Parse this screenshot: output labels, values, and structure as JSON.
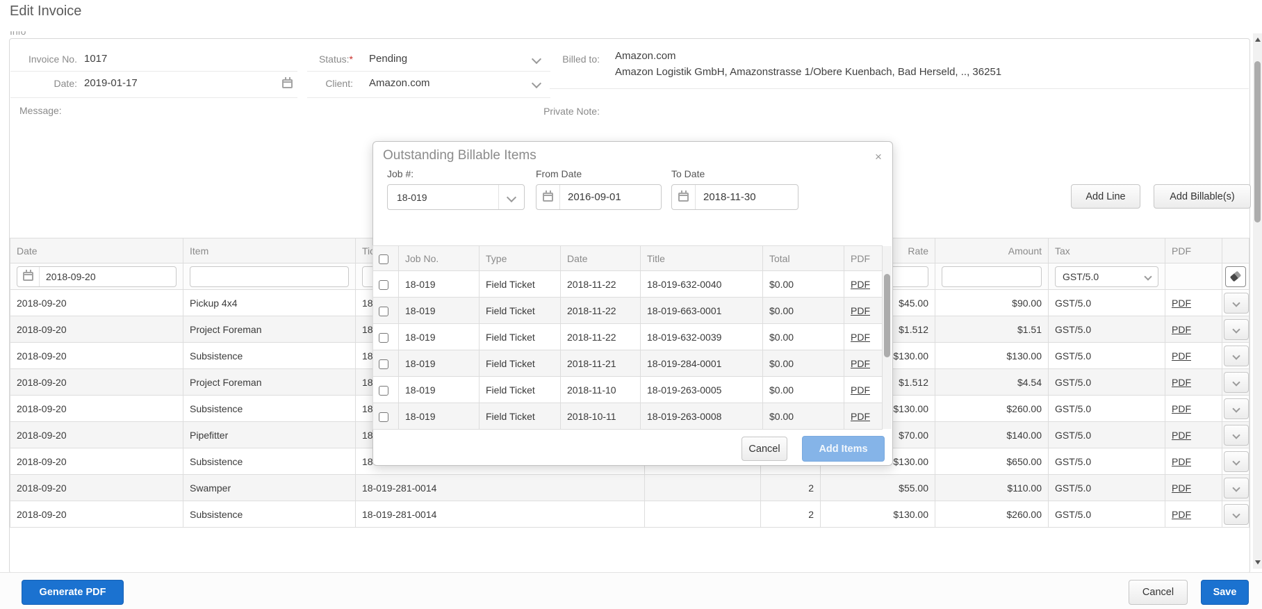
{
  "page": {
    "title": "Edit Invoice",
    "tab_fragment": "Info"
  },
  "form": {
    "invoice_no": {
      "label": "Invoice No.",
      "value": "1017"
    },
    "status": {
      "label": "Status:",
      "required_mark": "*",
      "value": "Pending"
    },
    "date": {
      "label": "Date:",
      "value": "2019-01-17"
    },
    "client": {
      "label": "Client:",
      "value": "Amazon.com"
    },
    "billed_to": {
      "label": "Billed to:",
      "line1": "Amazon.com",
      "line2": "Amazon Logistik GmbH, Amazonstrasse 1/Obere Kuenbach, Bad Herseld, .., 36251"
    },
    "message_label": "Message:",
    "private_note_label": "Private Note:"
  },
  "toolbar": {
    "add_line": "Add Line",
    "add_billables": "Add Billable(s)"
  },
  "invoice_table": {
    "headers": {
      "date": "Date",
      "item": "Item",
      "ticket": "Ticket No.",
      "rate": "Rate",
      "amount": "Amount",
      "tax": "Tax",
      "pdf": "PDF"
    },
    "filters": {
      "date": "2018-09-20",
      "tax": "GST/5.0"
    },
    "rows": [
      {
        "date": "2018-09-20",
        "item": "Pickup 4x4",
        "ticket": "18",
        "qty": "",
        "rate": "$45.00",
        "amount": "$90.00",
        "tax": "GST/5.0",
        "pdf": "PDF"
      },
      {
        "date": "2018-09-20",
        "item": "Project Foreman",
        "ticket": "18",
        "qty": "",
        "rate": "$1.512",
        "amount": "$1.51",
        "tax": "GST/5.0",
        "pdf": "PDF"
      },
      {
        "date": "2018-09-20",
        "item": "Subsistence",
        "ticket": "18",
        "qty": "",
        "rate": "$130.00",
        "amount": "$130.00",
        "tax": "GST/5.0",
        "pdf": "PDF"
      },
      {
        "date": "2018-09-20",
        "item": "Project Foreman",
        "ticket": "18",
        "qty": "",
        "rate": "$1.512",
        "amount": "$4.54",
        "tax": "GST/5.0",
        "pdf": "PDF"
      },
      {
        "date": "2018-09-20",
        "item": "Subsistence",
        "ticket": "18",
        "qty": "",
        "rate": "$130.00",
        "amount": "$260.00",
        "tax": "GST/5.0",
        "pdf": "PDF"
      },
      {
        "date": "2018-09-20",
        "item": "Pipefitter",
        "ticket": "18",
        "qty": "",
        "rate": "$70.00",
        "amount": "$140.00",
        "tax": "GST/5.0",
        "pdf": "PDF"
      },
      {
        "date": "2018-09-20",
        "item": "Subsistence",
        "ticket": "18",
        "qty": "",
        "rate": "$130.00",
        "amount": "$650.00",
        "tax": "GST/5.0",
        "pdf": "PDF"
      },
      {
        "date": "2018-09-20",
        "item": "Swamper",
        "ticket": "18-019-281-0014",
        "qty": "2",
        "rate": "$55.00",
        "amount": "$110.00",
        "tax": "GST/5.0",
        "pdf": "PDF"
      },
      {
        "date": "2018-09-20",
        "item": "Subsistence",
        "ticket": "18-019-281-0014",
        "qty": "2",
        "rate": "$130.00",
        "amount": "$260.00",
        "tax": "GST/5.0",
        "pdf": "PDF"
      }
    ]
  },
  "modal": {
    "title": "Outstanding Billable Items",
    "close": "×",
    "job": {
      "label": "Job #:",
      "value": "18-019"
    },
    "from_date": {
      "label": "From Date",
      "value": "2016-09-01"
    },
    "to_date": {
      "label": "To Date",
      "value": "2018-11-30"
    },
    "table": {
      "headers": {
        "job": "Job No.",
        "type": "Type",
        "date": "Date",
        "title": "Title",
        "total": "Total",
        "pdf": "PDF"
      },
      "rows": [
        {
          "job": "18-019",
          "type": "Field Ticket",
          "date": "2018-11-22",
          "title": "18-019-632-0040",
          "total": "$0.00",
          "pdf": "PDF"
        },
        {
          "job": "18-019",
          "type": "Field Ticket",
          "date": "2018-11-22",
          "title": "18-019-663-0001",
          "total": "$0.00",
          "pdf": "PDF"
        },
        {
          "job": "18-019",
          "type": "Field Ticket",
          "date": "2018-11-22",
          "title": "18-019-632-0039",
          "total": "$0.00",
          "pdf": "PDF"
        },
        {
          "job": "18-019",
          "type": "Field Ticket",
          "date": "2018-11-21",
          "title": "18-019-284-0001",
          "total": "$0.00",
          "pdf": "PDF"
        },
        {
          "job": "18-019",
          "type": "Field Ticket",
          "date": "2018-11-10",
          "title": "18-019-263-0005",
          "total": "$0.00",
          "pdf": "PDF"
        },
        {
          "job": "18-019",
          "type": "Field Ticket",
          "date": "2018-10-11",
          "title": "18-019-263-0008",
          "total": "$0.00",
          "pdf": "PDF"
        }
      ]
    },
    "cancel": "Cancel",
    "add_items": "Add Items"
  },
  "footer": {
    "generate_pdf": "Generate PDF",
    "cancel": "Cancel",
    "save": "Save"
  },
  "colors": {
    "primary": "#1b72d0",
    "primary_disabled": "#85b4e8"
  }
}
